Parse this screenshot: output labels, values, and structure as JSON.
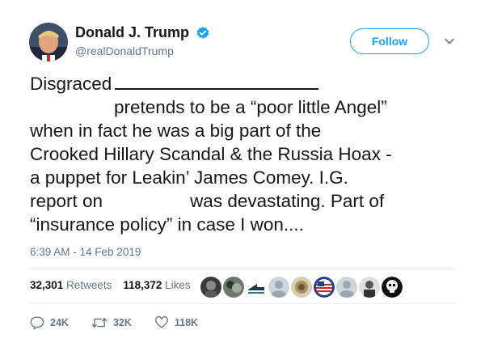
{
  "author": {
    "display_name": "Donald J. Trump",
    "handle": "@realDonaldTrump",
    "verified": true,
    "avatar_icon": "user-avatar"
  },
  "header": {
    "follow_label": "Follow"
  },
  "tweet": {
    "lines": [
      "Disgraced",
      "pretends to be a “poor little Angel”",
      "when in fact he was a big part of the",
      "Crooked Hillary Scandal & the Russia Hoax -",
      "a puppet for Leakin’ James Comey. I.G.",
      "report on",
      "was devastating. Part of",
      "“insurance policy” in case I won...."
    ]
  },
  "timestamp": "6:39 AM - 14 Feb 2019",
  "stats": {
    "retweets_count": "32,301",
    "retweets_label": "Retweets",
    "likes_count": "118,372",
    "likes_label": "Likes"
  },
  "actions": {
    "replies": "24K",
    "retweets": "32K",
    "likes": "118K"
  },
  "colors": {
    "accent": "#1da1f2",
    "text": "#14171a",
    "muted": "#657786",
    "divider": "#e6ecf0"
  }
}
